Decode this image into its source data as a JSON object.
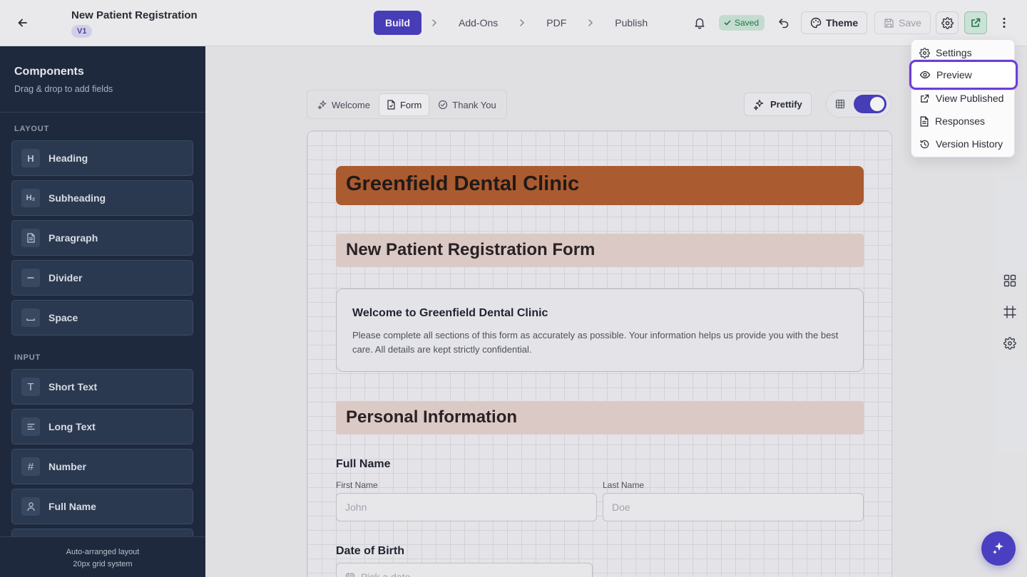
{
  "header": {
    "title": "New Patient Registration",
    "version": "V1",
    "steps": [
      "Build",
      "Add-Ons",
      "PDF",
      "Publish"
    ],
    "active_step": "Build",
    "saved_label": "Saved",
    "theme_label": "Theme",
    "save_label": "Save"
  },
  "sidebar": {
    "title": "Components",
    "subtitle": "Drag & drop to add fields",
    "layout_section": "LAYOUT",
    "layout_items": [
      {
        "label": "Heading",
        "icon": "H"
      },
      {
        "label": "Subheading",
        "icon": "H₂"
      },
      {
        "label": "Paragraph",
        "icon": "document-icon"
      },
      {
        "label": "Divider",
        "icon": "minus-icon"
      },
      {
        "label": "Space",
        "icon": "space-icon"
      }
    ],
    "input_section": "INPUT",
    "input_items": [
      {
        "label": "Short Text",
        "icon": "T"
      },
      {
        "label": "Long Text",
        "icon": "lines-icon"
      },
      {
        "label": "Number",
        "icon": "#"
      },
      {
        "label": "Full Name",
        "icon": "user-icon"
      }
    ],
    "footer_line1": "Auto-arranged layout",
    "footer_line2": "20px grid system"
  },
  "canvas": {
    "tabs": [
      "Welcome",
      "Form",
      "Thank You"
    ],
    "active_tab": "Form",
    "prettify_label": "Prettify",
    "grid_toggle_on": true
  },
  "form": {
    "clinic_title": "Greenfield Dental Clinic",
    "form_title": "New Patient Registration Form",
    "welcome_heading": "Welcome to Greenfield Dental Clinic",
    "welcome_text": "Please complete all sections of this form as accurately as possible. Your information helps us provide you with the best care. All details are kept strictly confidential.",
    "section_personal": "Personal Information",
    "full_name_label": "Full Name",
    "first_name_label": "First Name",
    "first_name_placeholder": "John",
    "last_name_label": "Last Name",
    "last_name_placeholder": "Doe",
    "dob_label": "Date of Birth",
    "dob_placeholder": "Pick a date"
  },
  "menu": {
    "items": [
      "Settings",
      "Preview",
      "View Published",
      "Responses",
      "Version History"
    ],
    "highlighted": "Preview"
  },
  "colors": {
    "primary": "#4a3fc0",
    "sidebar_bg": "#1e2a3e",
    "clinic_banner": "#b45f30",
    "section_banner": "#e7d4cf",
    "saved_green": "#21794a",
    "menu_highlight": "#6d3ed6"
  }
}
